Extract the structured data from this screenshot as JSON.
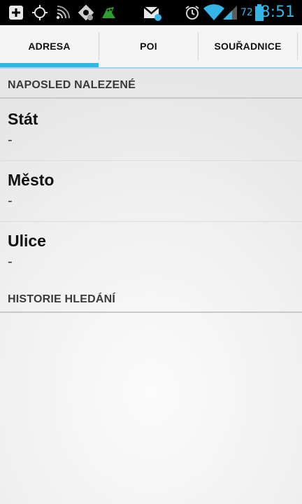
{
  "status_bar": {
    "time": "8:51",
    "battery_level": "72",
    "icons": [
      "add-box-icon",
      "gps-icon",
      "nfc-icon",
      "settings-sync-icon",
      "android-debug-icon",
      "gmail-icon",
      "alarm-icon",
      "wifi-icon",
      "signal-icon",
      "battery-icon"
    ]
  },
  "tabs": [
    {
      "label": "ADRESA",
      "selected": true
    },
    {
      "label": "POI",
      "selected": false
    },
    {
      "label": "SOUŘADNICE",
      "selected": false
    }
  ],
  "sections": {
    "recent": {
      "title": "NAPOSLED NALEZENÉ"
    },
    "history": {
      "title": "HISTORIE HLEDÁNÍ"
    }
  },
  "fields": [
    {
      "label": "Stát",
      "value": "-"
    },
    {
      "label": "Město",
      "value": "-"
    },
    {
      "label": "Ulice",
      "value": "-"
    }
  ],
  "colors": {
    "accent": "#33b5e5",
    "status_bar": "#000000"
  }
}
